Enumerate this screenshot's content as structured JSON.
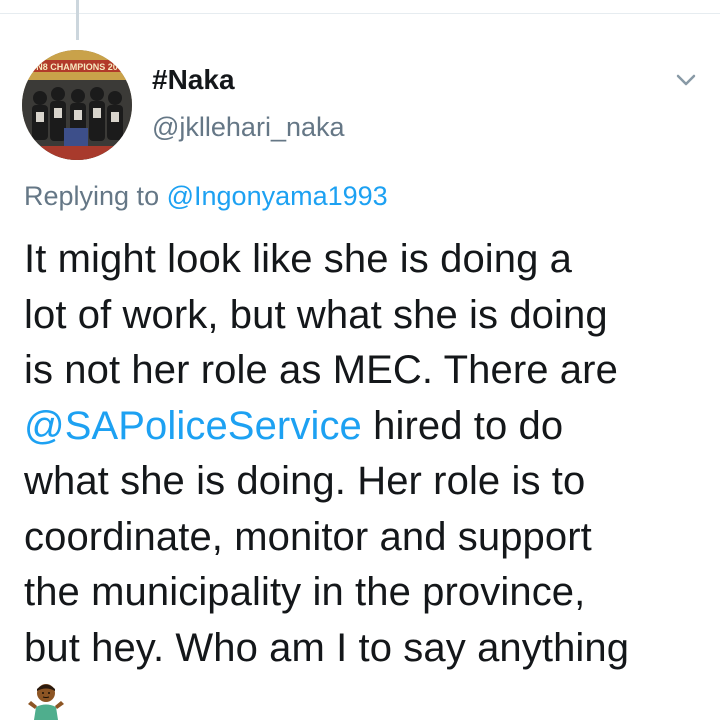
{
  "user": {
    "display_name": "#Naka",
    "handle": "@jkllehari_naka",
    "avatar_banner_text": "N8 CHAMPIONS 20"
  },
  "reply": {
    "prefix": "Replying to",
    "mention": "@Ingonyama1993"
  },
  "tweet": {
    "lines": [
      "It might look like she is doing a",
      "lot of work, but what she is doing",
      "is not her role as MEC. There are",
      "hired to do",
      "what she is doing. Her role is to",
      "coordinate, monitor and support",
      "the municipality in the province,",
      "but hey. Who am I to say anything"
    ],
    "mention": "@SAPoliceService",
    "emoji": "person-shrugging-emoji"
  },
  "icons": {
    "caret": "chevron-down-icon"
  },
  "colors": {
    "link": "#1da1f2",
    "secondary_text": "#657786",
    "primary_text": "#14171a",
    "divider": "#e6ecf0"
  }
}
